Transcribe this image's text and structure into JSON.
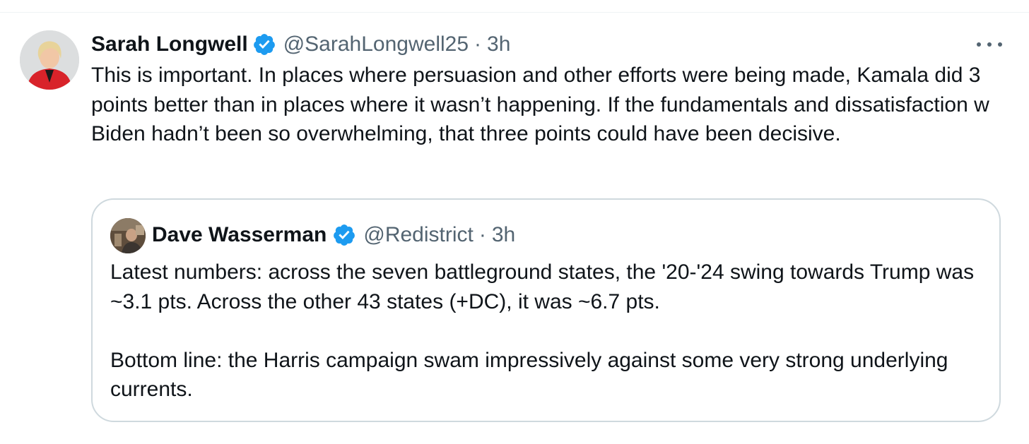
{
  "tweet": {
    "author_name": "Sarah Longwell",
    "handle": "@SarahLongwell25",
    "separator": "·",
    "time": "3h",
    "text": "This is important. In places where persuasion and other efforts were being made, Kamala did 3 points better than in places where it wasn’t happening. If the fundamentals and dissatisfaction w Biden hadn’t been so overwhelming, that three points could have been decisive.",
    "verified_icon": "verified-badge-icon",
    "more_icon": "more-options-icon"
  },
  "quoted_tweet": {
    "author_name": "Dave Wasserman",
    "handle": "@Redistrict",
    "separator": "·",
    "time": "3h",
    "text": "Latest numbers: across the seven battleground states, the '20-'24 swing towards Trump was ~3.1 pts. Across the other 43 states (+DC), it was ~6.7 pts.\n\nBottom line: the Harris campaign swam impressively against some very strong underlying currents.",
    "verified_icon": "verified-badge-icon"
  },
  "colors": {
    "verified_blue": "#1d9bf0",
    "secondary_text": "#536471",
    "border": "#cfd9de"
  }
}
